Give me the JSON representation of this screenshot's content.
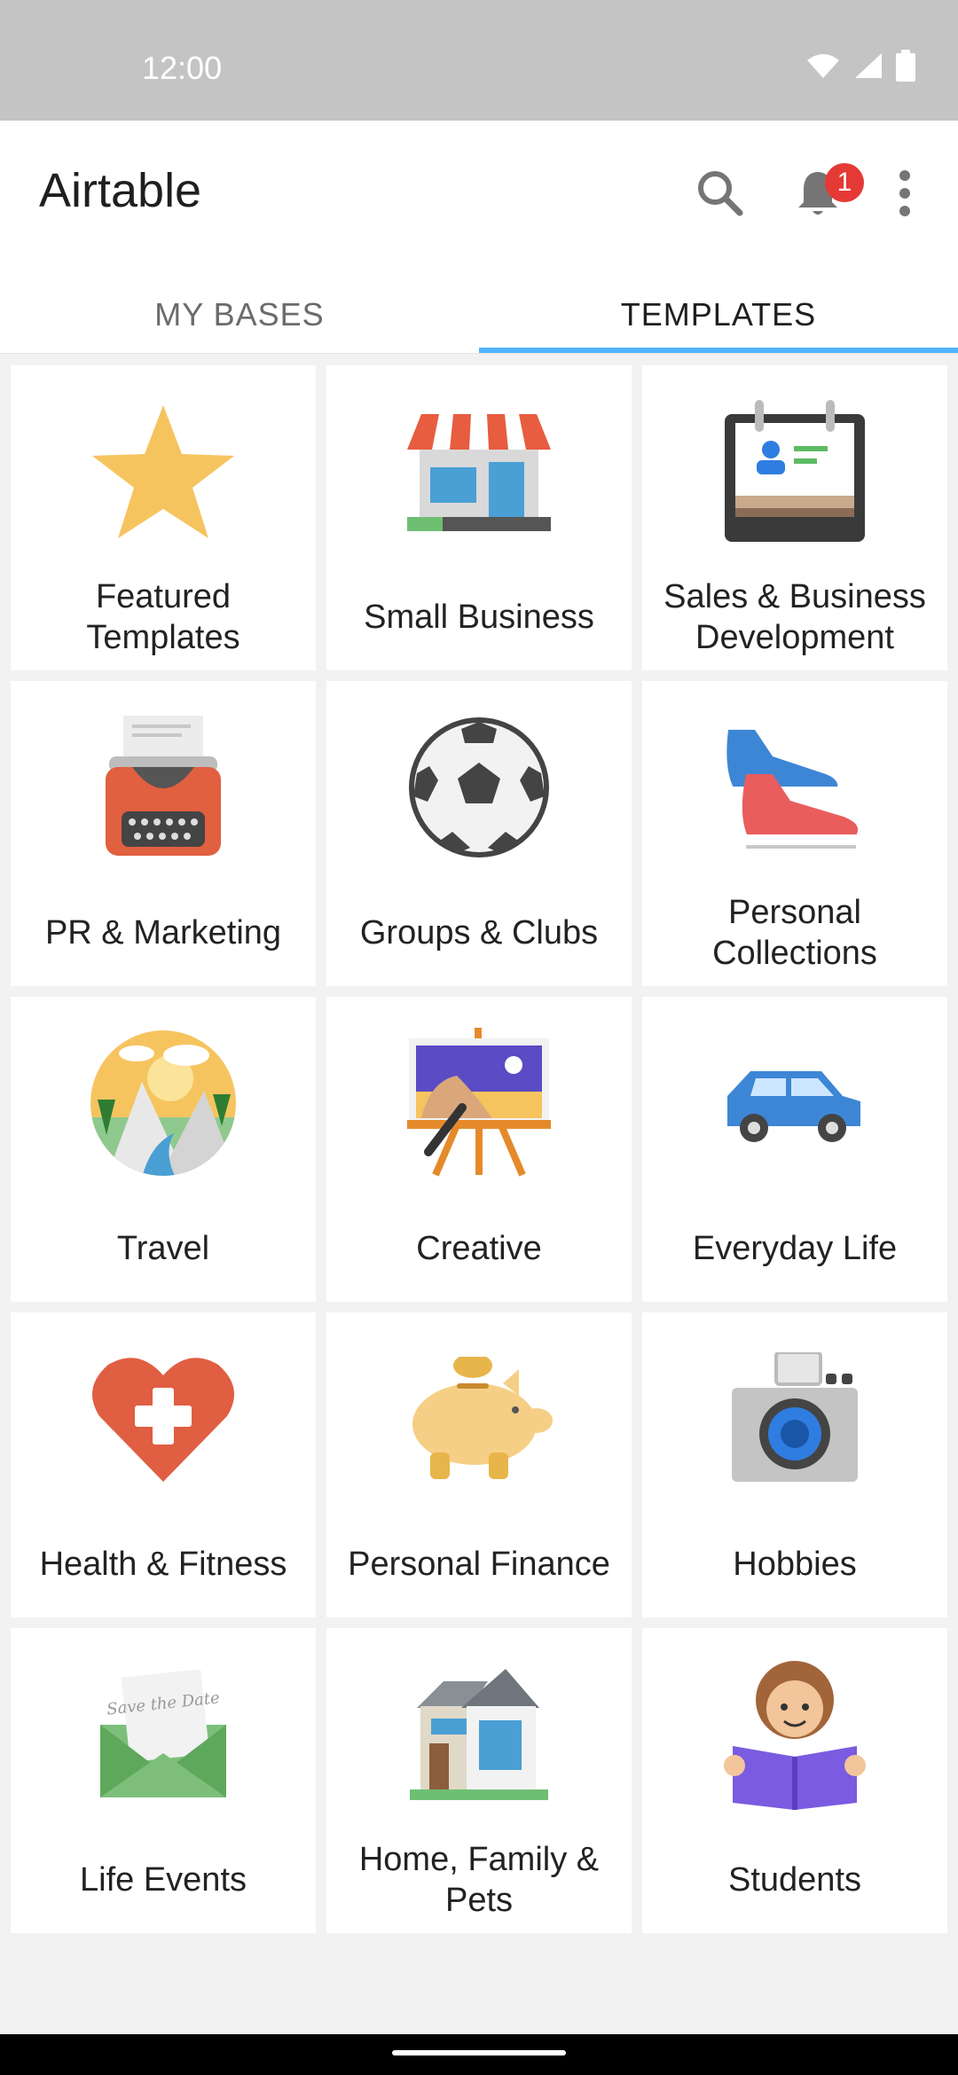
{
  "status_bar": {
    "time": "12:00",
    "icons": [
      "wifi-icon",
      "signal-icon",
      "battery-icon"
    ]
  },
  "app_bar": {
    "title": "Airtable",
    "notification_count": "1",
    "actions": [
      "search-icon",
      "bell-icon",
      "more-vert-icon"
    ]
  },
  "tabs": [
    {
      "label": "MY BASES",
      "active": false
    },
    {
      "label": "TEMPLATES",
      "active": true
    }
  ],
  "colors": {
    "tab_indicator": "#4eb4ff",
    "badge": "#e53935",
    "background": "#f2f2f2"
  },
  "categories": [
    {
      "label": "Featured Templates",
      "icon": "star-icon"
    },
    {
      "label": "Small Business",
      "icon": "storefront-icon"
    },
    {
      "label": "Sales & Business Development",
      "icon": "contact-calendar-icon"
    },
    {
      "label": "PR & Marketing",
      "icon": "typewriter-icon"
    },
    {
      "label": "Groups & Clubs",
      "icon": "soccer-ball-icon"
    },
    {
      "label": "Personal Collections",
      "icon": "sneakers-icon"
    },
    {
      "label": "Travel",
      "icon": "mountain-landscape-icon"
    },
    {
      "label": "Creative",
      "icon": "easel-painting-icon"
    },
    {
      "label": "Everyday Life",
      "icon": "car-icon"
    },
    {
      "label": "Health & Fitness",
      "icon": "heart-plus-icon"
    },
    {
      "label": "Personal Finance",
      "icon": "piggy-bank-icon"
    },
    {
      "label": "Hobbies",
      "icon": "camera-icon"
    },
    {
      "label": "Life Events",
      "icon": "save-the-date-envelope-icon"
    },
    {
      "label": "Home, Family & Pets",
      "icon": "house-icon"
    },
    {
      "label": "Students",
      "icon": "student-reading-icon"
    }
  ],
  "envelope_card_text": "Save the Date"
}
